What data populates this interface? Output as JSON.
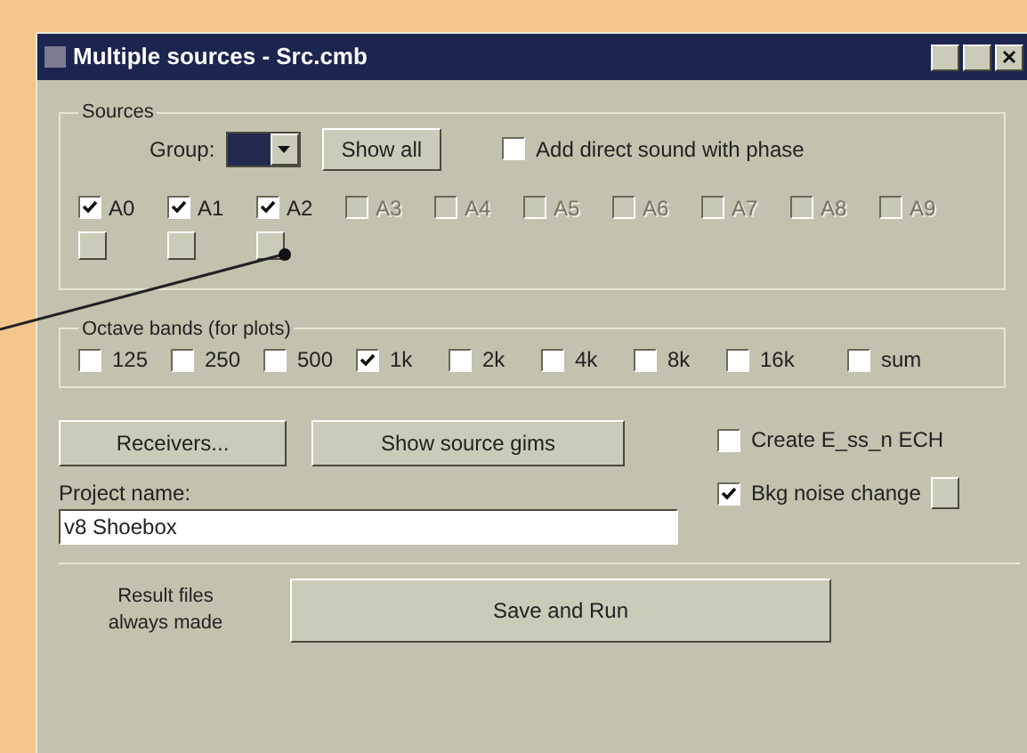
{
  "window": {
    "title": "Multiple sources - Src.cmb"
  },
  "sources": {
    "title": "Sources",
    "group_label": "Group:",
    "show_all": "Show all",
    "direct_sound": {
      "label": "Add direct sound with phase",
      "checked": false
    },
    "items": [
      {
        "label": "A0",
        "checked": true,
        "disabled": false
      },
      {
        "label": "A1",
        "checked": true,
        "disabled": false
      },
      {
        "label": "A2",
        "checked": true,
        "disabled": false
      },
      {
        "label": "A3",
        "checked": false,
        "disabled": true
      },
      {
        "label": "A4",
        "checked": false,
        "disabled": true
      },
      {
        "label": "A5",
        "checked": false,
        "disabled": true
      },
      {
        "label": "A6",
        "checked": false,
        "disabled": true
      },
      {
        "label": "A7",
        "checked": false,
        "disabled": true
      },
      {
        "label": "A8",
        "checked": false,
        "disabled": true
      },
      {
        "label": "A9",
        "checked": false,
        "disabled": true
      }
    ]
  },
  "octave": {
    "title": "Octave bands (for plots)",
    "items": [
      {
        "label": "125",
        "checked": false
      },
      {
        "label": "250",
        "checked": false
      },
      {
        "label": "500",
        "checked": false
      },
      {
        "label": "1k",
        "checked": true
      },
      {
        "label": "2k",
        "checked": false
      },
      {
        "label": "4k",
        "checked": false
      },
      {
        "label": "8k",
        "checked": false
      },
      {
        "label": "16k",
        "checked": false
      },
      {
        "label": "sum",
        "checked": false
      }
    ]
  },
  "buttons": [
    "Receivers...",
    "Show source gims"
  ],
  "options": [
    {
      "label": "Create E_ss_n ECH",
      "checked": false
    },
    {
      "label": "Bkg noise change",
      "checked": true
    }
  ],
  "project": {
    "label": "Project name:",
    "value": "v8 Shoebox"
  },
  "result_note": "Result files always made",
  "run_button": "Save and Run"
}
